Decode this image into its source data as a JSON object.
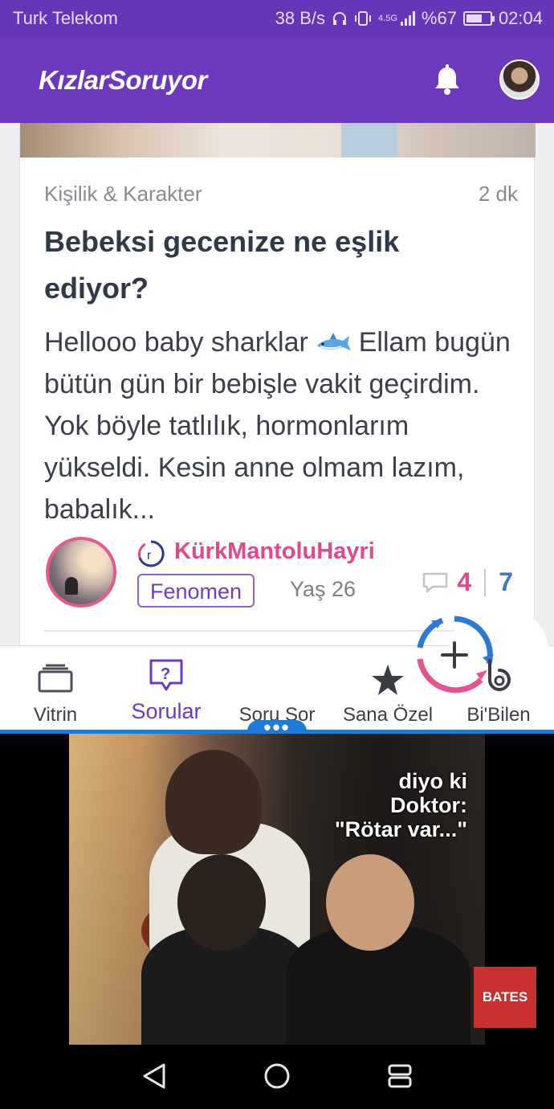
{
  "status_bar": {
    "carrier": "Turk Telekom",
    "speed": "38 B/s",
    "network": "4.5G",
    "battery": "%67",
    "battery_level": 0.67,
    "time": "02:04"
  },
  "app": {
    "logo": "KızlarSoruyor",
    "brand_color": "#6b39be"
  },
  "question": {
    "category": "Kişilik & Karakter",
    "time_ago": "2 dk",
    "title": "Bebeksi gecenize ne eşlik ediyor?",
    "excerpt_before_emoji": "Hellooo baby sharklar",
    "excerpt_after_emoji": "Ellam bugün bütün gün bir bebişle vakit geçirdim. Yok böyle tatlılık, hormonlarım yükseldi. Kesin anne olmam lazım, babalık...",
    "author": {
      "name": "KürkMantoluHayri",
      "rank": "Fenomen",
      "age": "Yaş 26"
    },
    "comment_count": "4",
    "answer_count": "7"
  },
  "bottom_nav": {
    "items": [
      {
        "label": "Vitrin",
        "icon": "showcase-icon"
      },
      {
        "label": "Sorular",
        "icon": "question-box-icon"
      },
      {
        "label": "Soru Sor",
        "icon": "add-question-icon"
      },
      {
        "label": "Sana Özel",
        "icon": "star-icon"
      },
      {
        "label": "Bi'Bilen",
        "icon": "bibilen-icon"
      }
    ],
    "active_index": 1
  },
  "video": {
    "caption_line1": "diyo ki",
    "caption_line2": "Doktor:",
    "caption_line3": "\"Rötar var...\"",
    "ad_badge": "BATES"
  },
  "pip_handle": "•••"
}
